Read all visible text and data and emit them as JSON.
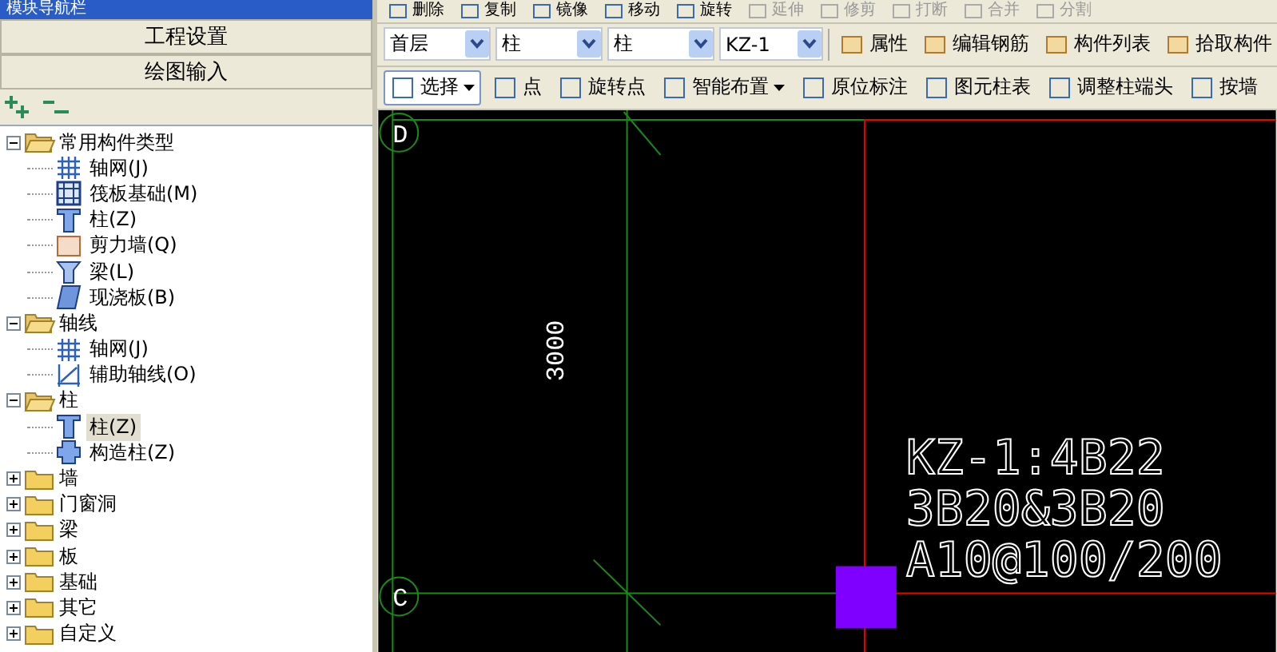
{
  "panel": {
    "title": "模块导航栏"
  },
  "nav_buttons": [
    {
      "label": "工程设置"
    },
    {
      "label": "绘图输入"
    }
  ],
  "tree": [
    {
      "label": "常用构件类型",
      "expanded": true,
      "children": [
        {
          "label": "轴网(J)",
          "kind": "grid",
          "selected": false
        },
        {
          "label": "筏板基础(M)",
          "kind": "raft",
          "selected": false
        },
        {
          "label": "柱(Z)",
          "kind": "column",
          "selected": false
        },
        {
          "label": "剪力墙(Q)",
          "kind": "wall",
          "selected": false
        },
        {
          "label": "梁(L)",
          "kind": "beam",
          "selected": false
        },
        {
          "label": "现浇板(B)",
          "kind": "slab",
          "selected": false
        }
      ]
    },
    {
      "label": "轴线",
      "expanded": true,
      "children": [
        {
          "label": "轴网(J)",
          "kind": "grid",
          "selected": false
        },
        {
          "label": "辅助轴线(O)",
          "kind": "aux",
          "selected": false
        }
      ]
    },
    {
      "label": "柱",
      "expanded": true,
      "children": [
        {
          "label": "柱(Z)",
          "kind": "column",
          "selected": true
        },
        {
          "label": "构造柱(Z)",
          "kind": "tiecolumn",
          "selected": false
        }
      ]
    },
    {
      "label": "墙",
      "expanded": false
    },
    {
      "label": "门窗洞",
      "expanded": false
    },
    {
      "label": "梁",
      "expanded": false
    },
    {
      "label": "板",
      "expanded": false
    },
    {
      "label": "基础",
      "expanded": false
    },
    {
      "label": "其它",
      "expanded": false
    },
    {
      "label": "自定义",
      "expanded": false
    }
  ],
  "edit_toolbar": [
    {
      "label": "删除",
      "disabled": false
    },
    {
      "label": "复制",
      "disabled": false
    },
    {
      "label": "镜像",
      "disabled": false
    },
    {
      "label": "移动",
      "disabled": false
    },
    {
      "label": "旋转",
      "disabled": false
    },
    {
      "label": "延伸",
      "disabled": true
    },
    {
      "label": "修剪",
      "disabled": true
    },
    {
      "label": "打断",
      "disabled": true
    },
    {
      "label": "合并",
      "disabled": true
    },
    {
      "label": "分割",
      "disabled": true
    }
  ],
  "selectors": [
    {
      "value": "首层"
    },
    {
      "value": "柱"
    },
    {
      "value": "柱"
    },
    {
      "value": "KZ-1"
    }
  ],
  "component_toolbar": [
    {
      "label": "属性"
    },
    {
      "label": "编辑钢筋"
    },
    {
      "label": "构件列表"
    },
    {
      "label": "拾取构件"
    }
  ],
  "draw_toolbar": [
    {
      "label": "选择",
      "dropdown": true,
      "selected": true
    },
    {
      "label": "点",
      "dropdown": false,
      "selected": false
    },
    {
      "label": "旋转点",
      "dropdown": false,
      "selected": false
    },
    {
      "label": "智能布置",
      "dropdown": true,
      "selected": false
    },
    {
      "label": "原位标注",
      "dropdown": false,
      "selected": false
    },
    {
      "label": "图元柱表",
      "dropdown": false,
      "selected": false
    },
    {
      "label": "调整柱端头",
      "dropdown": false,
      "selected": false
    },
    {
      "label": "按墙",
      "dropdown": false,
      "selected": false
    }
  ],
  "canvas": {
    "axis_labels": [
      "D",
      "C"
    ],
    "dimension": "3000",
    "annotation": [
      "KZ-1:4B22",
      "3B20&3B20",
      "A10@100/200"
    ]
  }
}
